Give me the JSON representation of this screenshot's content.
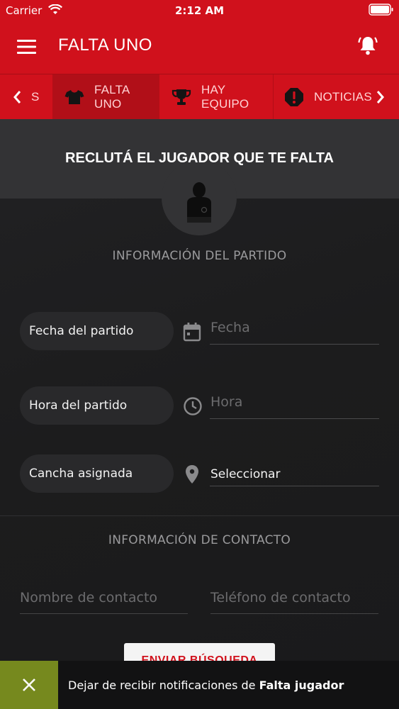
{
  "status_bar": {
    "carrier": "Carrier",
    "time": "2:12 AM"
  },
  "header": {
    "title": "FALTA UNO",
    "menu_icon": "hamburger-menu-icon",
    "bell_icon": "bell-alert-icon"
  },
  "tabs": [
    {
      "label": "S",
      "icon": "partial-tab"
    },
    {
      "label": "FALTA UNO",
      "icon": "shirt-icon",
      "active": true
    },
    {
      "label": "HAY EQUIPO",
      "icon": "trophy-icon"
    },
    {
      "label": "NOTICIAS",
      "icon": "alert-icon"
    }
  ],
  "hero": {
    "title": "RECLUTÁ EL JUGADOR QUE TE FALTA",
    "avatar_icon": "player-icon"
  },
  "match_info": {
    "section_title": "INFORMACIÓN DEL PARTIDO",
    "date_label": "Fecha del partido",
    "date_placeholder": "Fecha",
    "time_label": "Hora del partido",
    "time_placeholder": "Hora",
    "court_label": "Cancha asignada",
    "court_value": "Seleccionar"
  },
  "contact_info": {
    "section_title": "INFORMACIÓN DE CONTACTO",
    "name_placeholder": "Nombre de contacto",
    "phone_placeholder": "Teléfono de contacto"
  },
  "submit": {
    "label": "ENVIAR BÚSQUEDA"
  },
  "snackbar": {
    "text_prefix": "Dejar de recibir notificaciones de ",
    "text_bold": "Falta jugador"
  },
  "colors": {
    "brand_red": "#d0111c",
    "snackbar_green": "#76891e",
    "background": "#1e1e1f"
  }
}
